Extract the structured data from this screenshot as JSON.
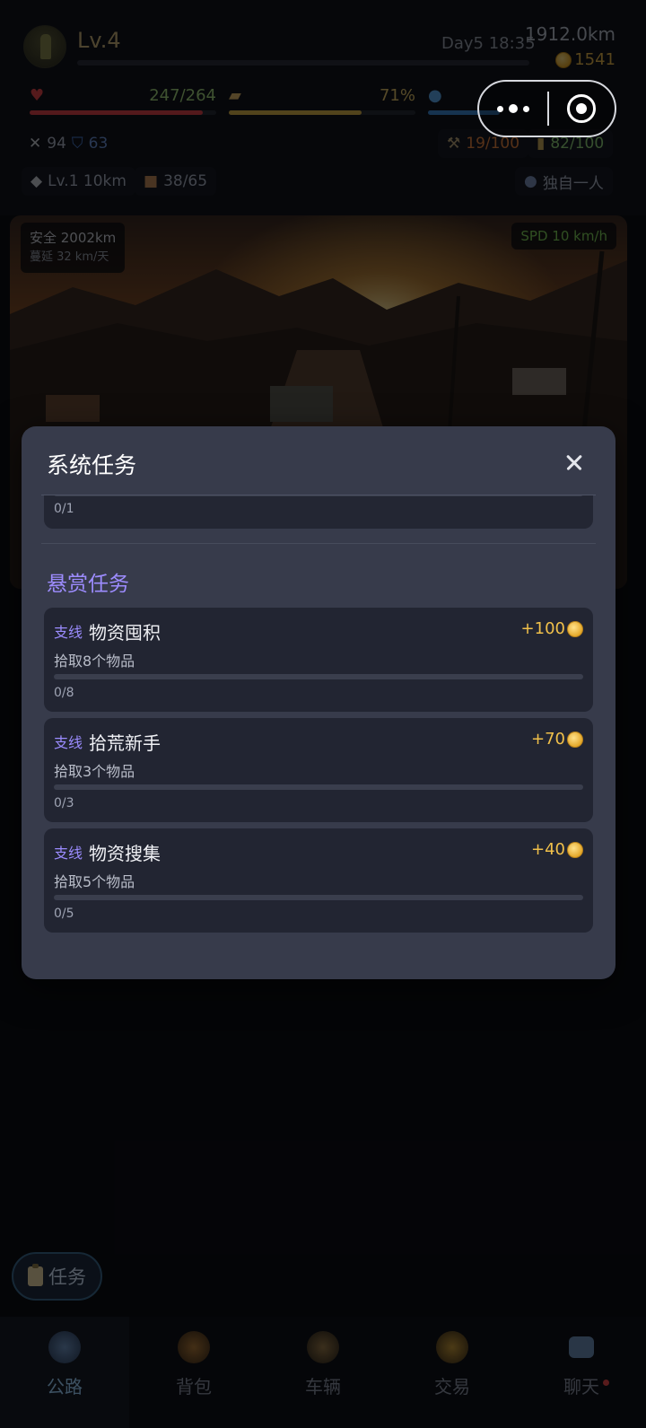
{
  "player": {
    "level": "Lv.4",
    "day_time": "Day5 18:35",
    "distance": "1912.0km",
    "coins": "1541"
  },
  "stats": {
    "health": "247/264",
    "food": "71%"
  },
  "combat": {
    "attack": "94",
    "defense": "63"
  },
  "durability": {
    "repair": "19/100",
    "fuel": "82/100"
  },
  "chips": {
    "vehicle": "Lv.1 10km",
    "cargo": "38/65",
    "team": "独自一人"
  },
  "scene": {
    "safe_distance": "安全 2002km",
    "spread": "蔓延 32 km/天",
    "speed": "SPD 10 km/h"
  },
  "modal": {
    "title": "系统任务",
    "prev_progress": "0/1",
    "section_title": "悬赏任务",
    "tasks": [
      {
        "tag": "支线",
        "name": "物资囤积",
        "reward": "+100",
        "desc": "拾取8个物品",
        "progress": "0/8",
        "ratio": 0
      },
      {
        "tag": "支线",
        "name": "拾荒新手",
        "reward": "+70",
        "desc": "拾取3个物品",
        "progress": "0/3",
        "ratio": 0
      },
      {
        "tag": "支线",
        "name": "物资搜集",
        "reward": "+40",
        "desc": "拾取5个物品",
        "progress": "0/5",
        "ratio": 0
      }
    ]
  },
  "task_button": "任务",
  "tabs": [
    {
      "label": "公路",
      "active": true
    },
    {
      "label": "背包",
      "active": false
    },
    {
      "label": "车辆",
      "active": false
    },
    {
      "label": "交易",
      "active": false
    },
    {
      "label": "聊天",
      "active": false
    }
  ],
  "icons": {
    "close": "close-icon",
    "coin": "coin-icon",
    "heart": "heart-icon",
    "bread": "bread-icon",
    "water": "water-drop-icon"
  },
  "colors": {
    "modal_bg": "#373b4b",
    "card_bg": "#222532",
    "accent_purple": "#9d8cff",
    "reward_gold": "#f0c04a"
  }
}
